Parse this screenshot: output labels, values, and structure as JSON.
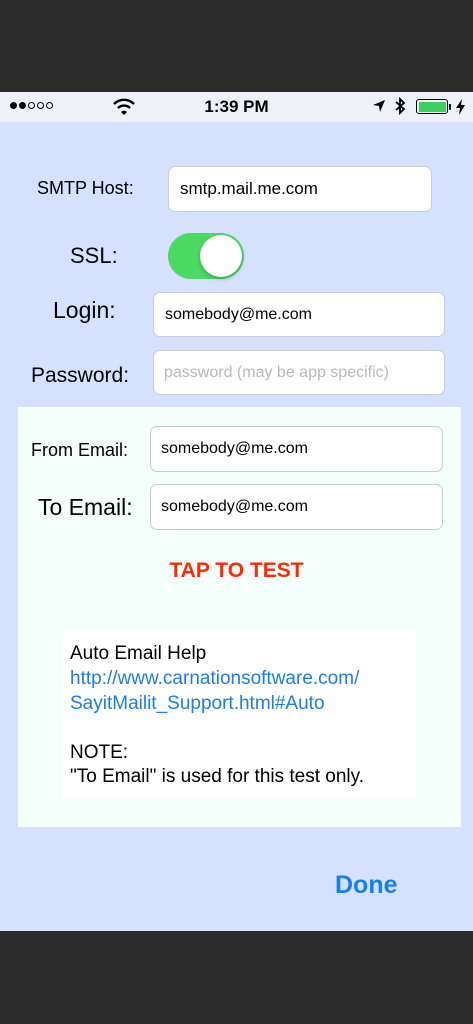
{
  "status_bar": {
    "time": "1:39 PM",
    "signal_filled": 2,
    "signal_total": 5,
    "battery_level": 1.0,
    "battery_color": "#3bd15f"
  },
  "form": {
    "smtp_host": {
      "label": "SMTP Host:",
      "value": "smtp.mail.me.com"
    },
    "ssl": {
      "label": "SSL:",
      "on": true
    },
    "login": {
      "label": "Login:",
      "value": "somebody@me.com"
    },
    "password": {
      "label": "Password:",
      "value": "",
      "placeholder": "password (may be app specific)"
    },
    "from_email": {
      "label": "From Email:",
      "value": "somebody@me.com"
    },
    "to_email": {
      "label": "To Email:",
      "value": "somebody@me.com"
    }
  },
  "test_button": {
    "label": "TAP TO TEST",
    "color": "#ff2a00"
  },
  "help": {
    "title": "Auto Email Help",
    "link_line1": "http://www.carnationsoftware.com/",
    "link_line2": "SayitMailit_Support.html#Auto",
    "note_title": "NOTE:",
    "note_text": "\"To Email\" is used for this test only."
  },
  "done_button": {
    "label": "Done",
    "color": "#1680ec"
  },
  "colors": {
    "background": "#d5e1ff",
    "panel": "#f4fffb",
    "toggle_on": "#4cd964",
    "link": "#1d7ee0"
  }
}
